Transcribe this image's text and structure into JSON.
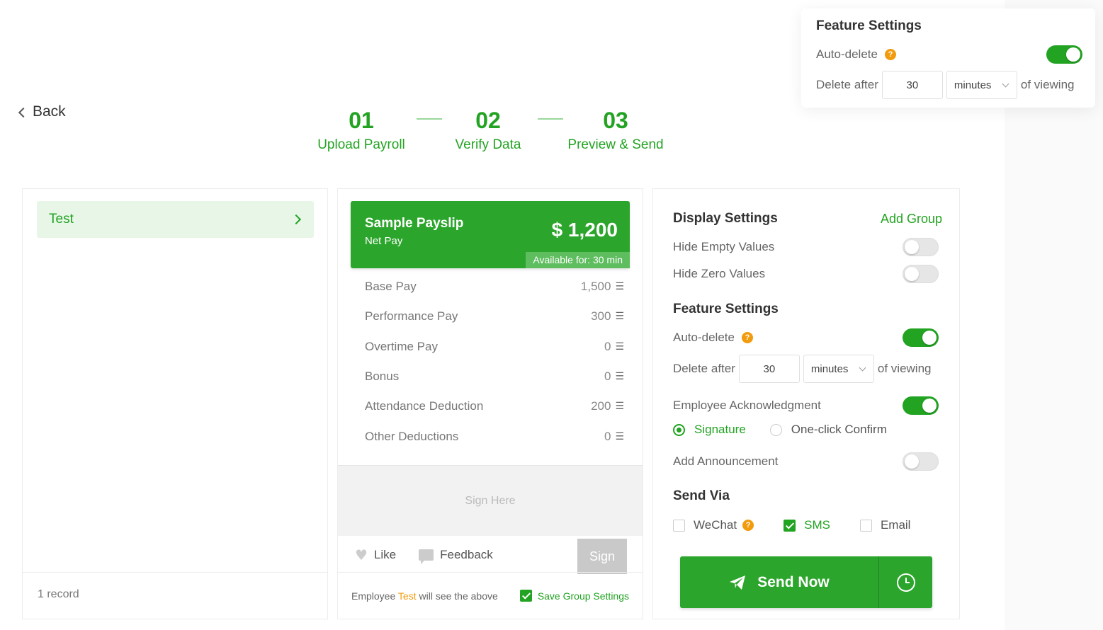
{
  "nav": {
    "back_label": "Back"
  },
  "steps": [
    {
      "num": "01",
      "label": "Upload Payroll"
    },
    {
      "num": "02",
      "label": "Verify Data"
    },
    {
      "num": "03",
      "label": "Preview & Send"
    }
  ],
  "groups": {
    "items": [
      {
        "label": "Test"
      }
    ],
    "record_count": "1 record"
  },
  "payslip": {
    "title": "Sample Payslip",
    "subtitle": "Net Pay",
    "amount": "$ 1,200",
    "available_label": "Available for:",
    "available_value": "30 min",
    "rows": [
      {
        "label": "Base Pay",
        "value": "1,500"
      },
      {
        "label": "Performance Pay",
        "value": "300"
      },
      {
        "label": "Overtime Pay",
        "value": "0"
      },
      {
        "label": "Bonus",
        "value": "0"
      },
      {
        "label": "Attendance Deduction",
        "value": "200"
      },
      {
        "label": "Other Deductions",
        "value": "0"
      }
    ],
    "sign_here": "Sign Here",
    "like_label": "Like",
    "feedback_label": "Feedback",
    "sign_button": "Sign",
    "footer_prefix": "Employee",
    "footer_name": "Test",
    "footer_suffix": "will see the above",
    "save_group_settings": "Save Group Settings"
  },
  "settings": {
    "display_title": "Display Settings",
    "add_group": "Add Group",
    "hide_empty": "Hide Empty Values",
    "hide_zero": "Hide Zero Values",
    "feature_title": "Feature Settings",
    "auto_delete": "Auto-delete",
    "delete_after": "Delete after",
    "delete_value": "30",
    "delete_unit": "minutes",
    "of_viewing": "of viewing",
    "employee_ack": "Employee Acknowledgment",
    "radio_signature": "Signature",
    "radio_one_click": "One-click Confirm",
    "add_announcement": "Add Announcement",
    "send_via_title": "Send Via",
    "wechat": "WeChat",
    "sms": "SMS",
    "email": "Email",
    "send_now": "Send Now"
  },
  "floating": {
    "title": "Feature Settings",
    "auto_delete": "Auto-delete",
    "delete_after": "Delete after",
    "delete_value": "30",
    "delete_unit": "minutes",
    "of_viewing": "of viewing"
  },
  "icons": {
    "back": "chevron-left-icon",
    "group_item": "chevron-right-icon",
    "row_detail": "list-detail-icon",
    "like": "heart-icon",
    "feedback": "chat-icon",
    "help": "question-icon",
    "send": "paper-plane-icon",
    "schedule": "clock-icon"
  },
  "colors": {
    "accent": "#22a322",
    "header_green": "#2ba52b",
    "warning": "#f29b0c"
  }
}
